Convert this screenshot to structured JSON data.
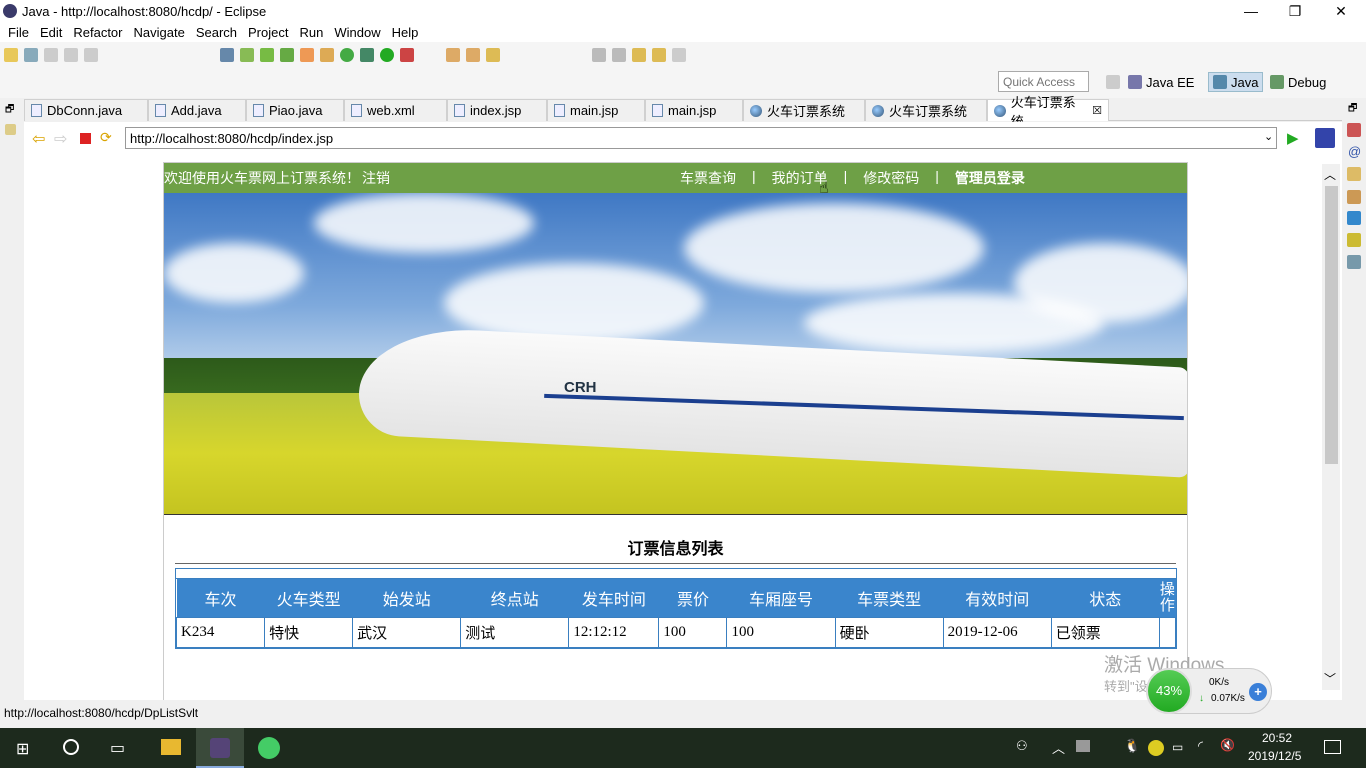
{
  "window": {
    "title": "Java - http://localhost:8080/hcdp/ - Eclipse",
    "minimize": "—",
    "restore": "❐",
    "close": "✕"
  },
  "menu": [
    "File",
    "Edit",
    "Refactor",
    "Navigate",
    "Search",
    "Project",
    "Run",
    "Window",
    "Help"
  ],
  "perspectives": {
    "quick_access_placeholder": "Quick Access",
    "items": [
      "Java EE",
      "Java",
      "Debug"
    ]
  },
  "editor_tabs": [
    {
      "label": "DbConn.java",
      "icon": "java-file-icon"
    },
    {
      "label": "Add.java",
      "icon": "java-file-icon"
    },
    {
      "label": "Piao.java",
      "icon": "java-file-icon"
    },
    {
      "label": "web.xml",
      "icon": "xml-file-icon"
    },
    {
      "label": "index.jsp",
      "icon": "jsp-file-icon"
    },
    {
      "label": "main.jsp",
      "icon": "jsp-file-icon"
    },
    {
      "label": "main.jsp",
      "icon": "jsp-file-icon"
    },
    {
      "label": "火车订票系统",
      "icon": "globe-icon"
    },
    {
      "label": "火车订票系统",
      "icon": "globe-icon"
    },
    {
      "label": "火车订票系统",
      "icon": "globe-icon",
      "active": true
    }
  ],
  "browser": {
    "url": "http://localhost:8080/hcdp/index.jsp"
  },
  "site": {
    "welcome": "欢迎使用火车票网上订票系统！",
    "logout": "注销",
    "nav": [
      "车票查询",
      "我的订单",
      "修改密码"
    ],
    "separator": "|",
    "admin_login": "管理员登录",
    "nav_color": "#6ea046",
    "banner_logo": "CRH",
    "section_title": "订票信息列表",
    "table": {
      "headers": [
        "车次",
        "火车类型",
        "始发站",
        "终点站",
        "发车时间",
        "票价",
        "车厢座号",
        "车票类型",
        "有效时间",
        "状态",
        "操作"
      ],
      "rows": [
        [
          "K234",
          "特快",
          "武汉",
          "测试",
          "12:12:12",
          "100",
          "100",
          "硬卧",
          "2019-12-06",
          "已领票",
          ""
        ]
      ],
      "header_color": "#3a85cc"
    }
  },
  "status_bar": "http://localhost:8080/hcdp/DpListSvlt",
  "watermark": {
    "line1": "激活 Windows",
    "line2": "转到\"设置\"以激活 Windows。"
  },
  "net_monitor": {
    "percent": "43%",
    "up": "0K/s",
    "down": "0.07K/s"
  },
  "taskbar": {
    "time": "20:52",
    "date": "2019/12/5"
  }
}
